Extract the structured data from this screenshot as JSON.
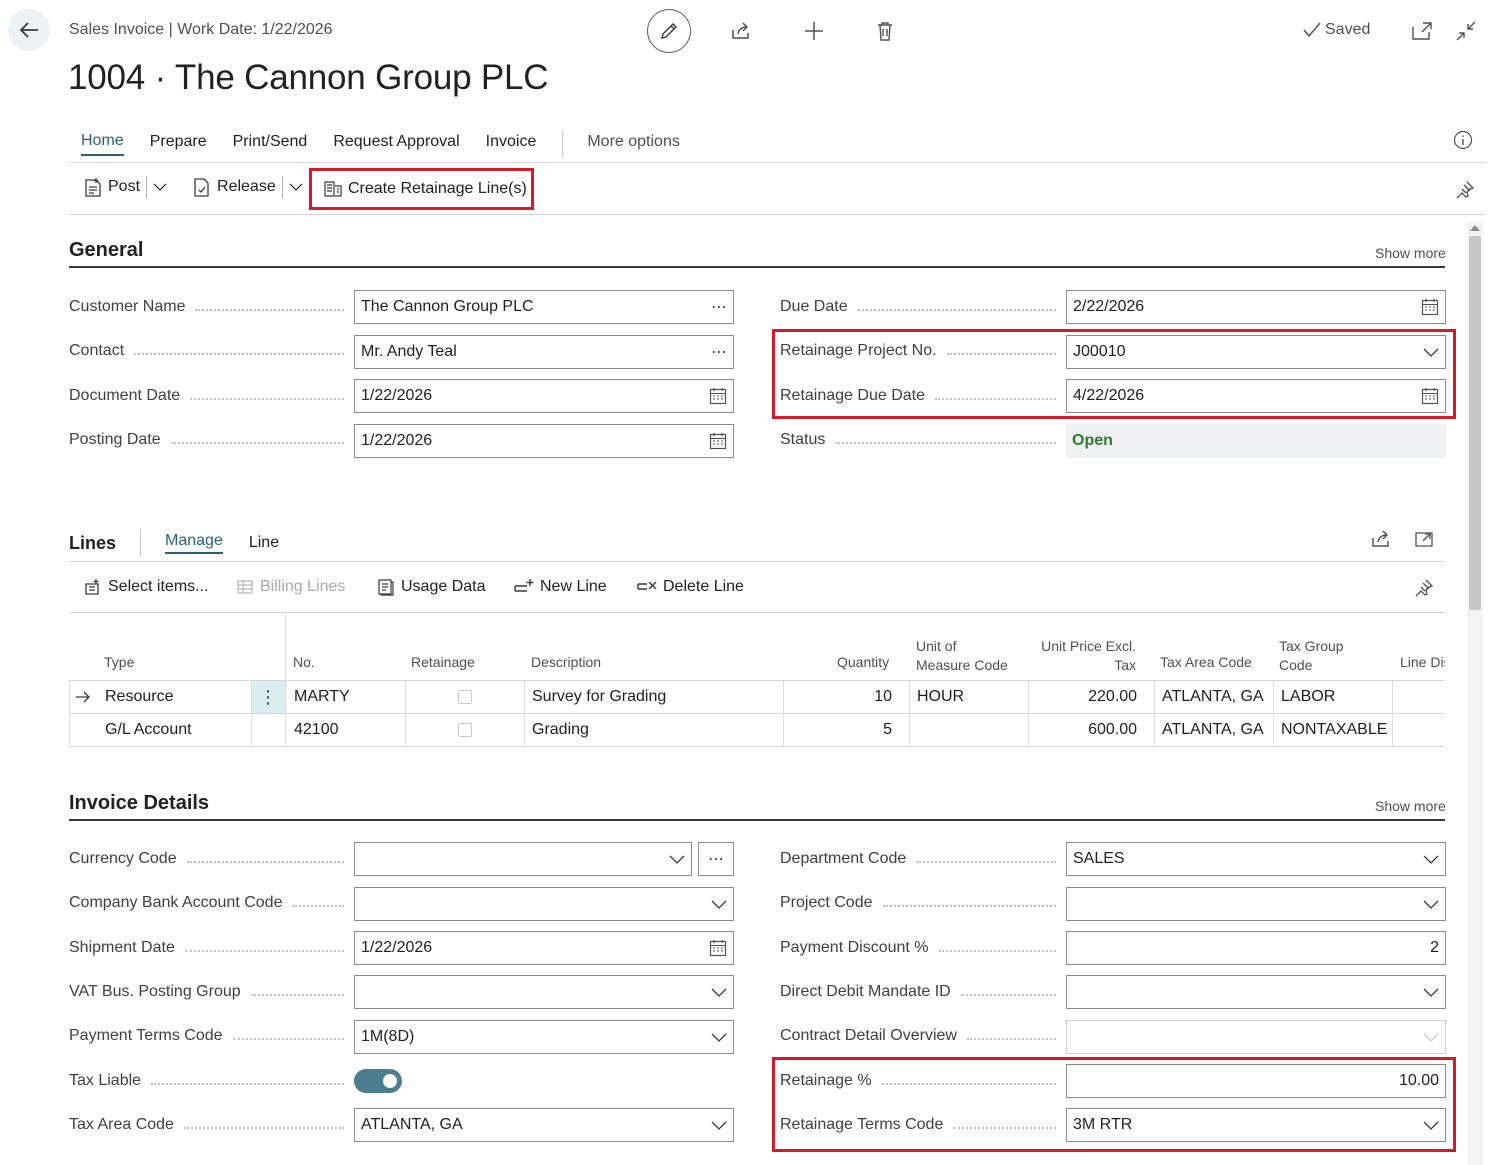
{
  "header": {
    "breadcrumb": "Sales Invoice | Work Date: 1/22/2026",
    "title": "1004 · The Cannon Group PLC",
    "saved": "Saved"
  },
  "tabs": {
    "home": "Home",
    "prepare": "Prepare",
    "print_send": "Print/Send",
    "request_approval": "Request Approval",
    "invoice": "Invoice",
    "more_options": "More options"
  },
  "actions": {
    "post": "Post",
    "release": "Release",
    "create_retainage": "Create Retainage Line(s)"
  },
  "general": {
    "title": "General",
    "show_more": "Show more",
    "customer_name_label": "Customer Name",
    "customer_name": "The Cannon Group PLC",
    "contact_label": "Contact",
    "contact": "Mr. Andy Teal",
    "document_date_label": "Document Date",
    "document_date": "1/22/2026",
    "posting_date_label": "Posting Date",
    "posting_date": "1/22/2026",
    "due_date_label": "Due Date",
    "due_date": "2/22/2026",
    "retainage_project_label": "Retainage Project No.",
    "retainage_project": "J00010",
    "retainage_due_label": "Retainage Due Date",
    "retainage_due": "4/22/2026",
    "status_label": "Status",
    "status": "Open"
  },
  "lines": {
    "title": "Lines",
    "tab_manage": "Manage",
    "tab_line": "Line",
    "select_items": "Select items...",
    "billing_lines": "Billing Lines",
    "usage_data": "Usage Data",
    "new_line": "New Line",
    "delete_line": "Delete Line",
    "columns": {
      "type": "Type",
      "no": "No.",
      "retainage": "Retainage",
      "description": "Description",
      "quantity": "Quantity",
      "uom_1": "Unit of",
      "uom_2": "Measure Code",
      "unit_price_1": "Unit Price Excl.",
      "unit_price_2": "Tax",
      "tax_area": "Tax Area Code",
      "tax_group_1": "Tax Group",
      "tax_group_2": "Code",
      "line_dis": "Line Dis"
    },
    "rows": [
      {
        "type": "Resource",
        "no": "MARTY",
        "description": "Survey for Grading",
        "quantity": "10",
        "uom": "HOUR",
        "unit_price": "220.00",
        "tax_area": "ATLANTA, GA",
        "tax_group": "LABOR"
      },
      {
        "type": "G/L Account",
        "no": "42100",
        "description": "Grading",
        "quantity": "5",
        "uom": "",
        "unit_price": "600.00",
        "tax_area": "ATLANTA, GA",
        "tax_group": "NONTAXABLE"
      }
    ]
  },
  "invoice_details": {
    "title": "Invoice Details",
    "show_more": "Show more",
    "currency_code_label": "Currency Code",
    "currency_code": "",
    "company_bank_label": "Company Bank Account Code",
    "company_bank": "",
    "shipment_date_label": "Shipment Date",
    "shipment_date": "1/22/2026",
    "vat_bus_label": "VAT Bus. Posting Group",
    "vat_bus": "",
    "payment_terms_label": "Payment Terms Code",
    "payment_terms": "1M(8D)",
    "tax_liable_label": "Tax Liable",
    "tax_liable": true,
    "tax_area_label": "Tax Area Code",
    "tax_area": "ATLANTA, GA",
    "department_label": "Department Code",
    "department": "SALES",
    "project_code_label": "Project Code",
    "project_code": "",
    "payment_discount_label": "Payment Discount %",
    "payment_discount": "2",
    "direct_debit_label": "Direct Debit Mandate ID",
    "direct_debit": "",
    "contract_detail_label": "Contract Detail Overview",
    "contract_detail": "",
    "retainage_pct_label": "Retainage %",
    "retainage_pct": "10.00",
    "retainage_terms_label": "Retainage Terms Code",
    "retainage_terms": "3M RTR"
  },
  "colors": {
    "accent": "#2a6173",
    "highlight": "#d71a28",
    "status_open": "#2f7a2f"
  }
}
